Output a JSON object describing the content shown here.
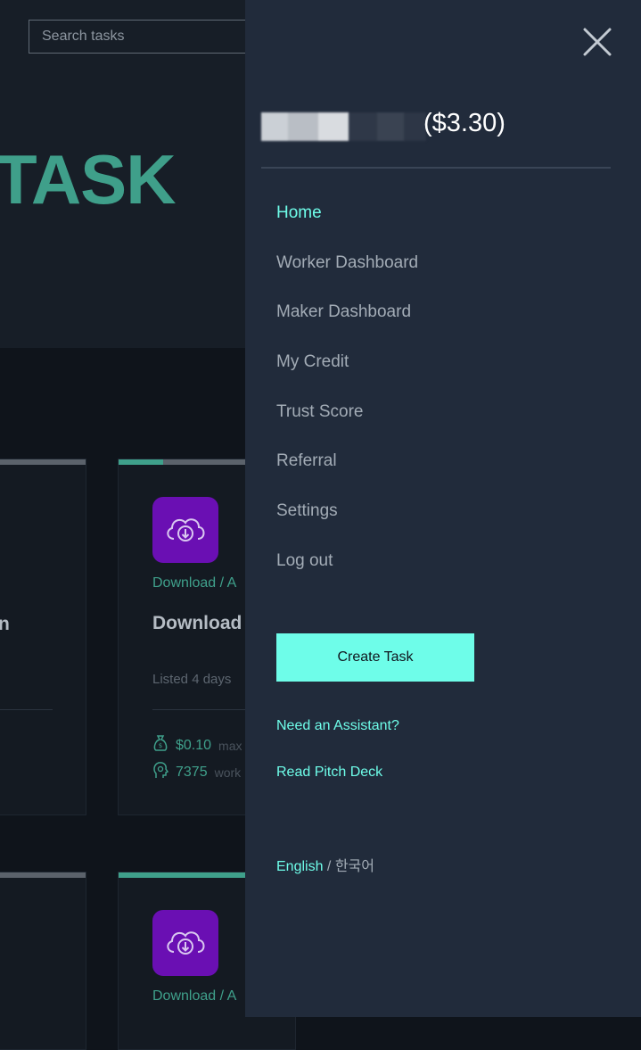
{
  "search": {
    "placeholder": "Search tasks"
  },
  "hero": {
    "title": "TASK"
  },
  "cards": [
    {
      "category": "Download / A",
      "title": "Download",
      "listed": "Listed 4 days",
      "reward": "$0.10",
      "reward_sub": "max",
      "workers": "7375",
      "workers_sub": "work",
      "progress": 0.25
    },
    {
      "category": "Download / A",
      "progress": 1.0
    }
  ],
  "left_fragment": {
    "title": "n"
  },
  "drawer": {
    "balance": "($3.30)",
    "nav": [
      {
        "label": "Home",
        "active": true
      },
      {
        "label": "Worker Dashboard"
      },
      {
        "label": "Maker Dashboard"
      },
      {
        "label": "My Credit"
      },
      {
        "label": "Trust Score"
      },
      {
        "label": "Referral"
      },
      {
        "label": "Settings"
      },
      {
        "label": "Log out"
      }
    ],
    "create_task": "Create Task",
    "need_assistant": "Need an Assistant?",
    "pitch_deck": "Read Pitch Deck",
    "lang_current": "English",
    "lang_sep": " / ",
    "lang_alt": "한국어"
  },
  "colors": {
    "accent": "#6efde9",
    "drawer_bg": "#212b3b",
    "teal": "#3fa08b",
    "icon_bg": "#6a0fb3"
  },
  "icons": {
    "close": "close-icon",
    "card": "cloud-download-icon",
    "reward": "money-bag-icon",
    "workers": "worker-head-icon"
  }
}
